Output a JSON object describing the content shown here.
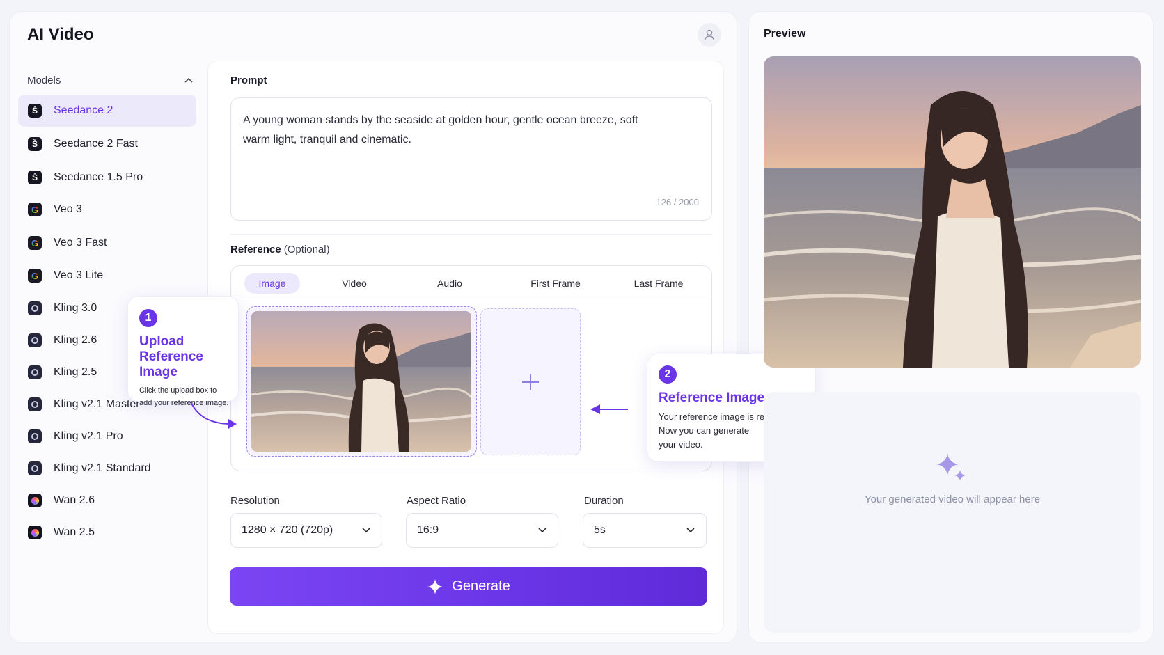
{
  "app": {
    "title": "AI Video"
  },
  "sidebar": {
    "section_label": "Models",
    "items": [
      {
        "label": "Seedance 2",
        "icon": "seedance-icon",
        "active": true
      },
      {
        "label": "Seedance 2 Fast",
        "icon": "seedance-icon"
      },
      {
        "label": "Seedance 1.5 Pro",
        "icon": "seedance-icon"
      },
      {
        "label": "Veo 3",
        "icon": "google-icon"
      },
      {
        "label": "Veo 3 Fast",
        "icon": "google-icon"
      },
      {
        "label": "Veo 3 Lite",
        "icon": "google-icon"
      },
      {
        "label": "Kling 3.0",
        "icon": "kling-icon"
      },
      {
        "label": "Kling 2.6",
        "icon": "kling-icon"
      },
      {
        "label": "Kling 2.5",
        "icon": "kling-icon"
      },
      {
        "label": "Kling v2.1 Master",
        "icon": "kling-icon"
      },
      {
        "label": "Kling v2.1 Pro",
        "icon": "kling-icon"
      },
      {
        "label": "Kling v2.1 Standard",
        "icon": "kling-icon"
      },
      {
        "label": "Wan 2.6",
        "icon": "wan-icon"
      },
      {
        "label": "Wan 2.5",
        "icon": "wan-icon"
      }
    ]
  },
  "prompt": {
    "label": "Prompt",
    "text": "A young woman stands by the seaside at golden hour, gentle ocean breeze, soft warm light, tranquil and cinematic.",
    "char_count": "126 / 2000"
  },
  "reference": {
    "label": "Reference",
    "optional": "(Optional)",
    "tabs": [
      "Image",
      "Video",
      "Audio",
      "First Frame",
      "Last Frame"
    ],
    "active_tab": "Image"
  },
  "callouts": {
    "upload": {
      "number": "1",
      "title_line1": "Upload",
      "title_line2": "Reference Image",
      "body_line1": "Click the upload box to",
      "body_line2": "add your reference image."
    },
    "added": {
      "number": "2",
      "title": "Reference Image Added",
      "body_line1": "Your reference image is ready.",
      "body_line2": "Now you can generate",
      "body_line3": "your video."
    }
  },
  "settings": {
    "resolution": {
      "label": "Resolution",
      "value": "1280 × 720 (720p)"
    },
    "aspect_ratio": {
      "label": "Aspect Ratio",
      "value": "16:9"
    },
    "duration": {
      "label": "Duration",
      "value": "5s"
    }
  },
  "generate_label": "Generate",
  "preview": {
    "title": "Preview",
    "placeholder": "Your generated video will appear here"
  },
  "colors": {
    "accent": "#6a35e6",
    "accent_soft": "#ede9fd"
  }
}
